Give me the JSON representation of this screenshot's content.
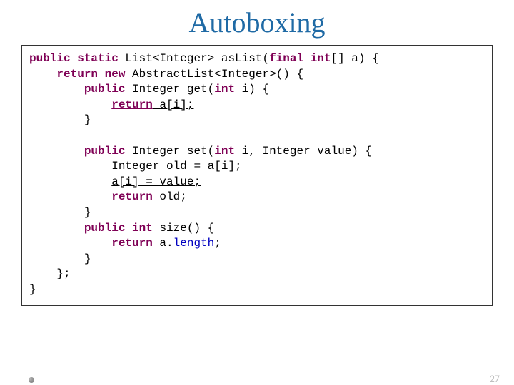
{
  "title": "Autoboxing",
  "slide_number": "27",
  "code": {
    "l1": {
      "a": "public",
      "b": " ",
      "c": "static",
      "d": " List<Integer> asList(",
      "e": "final",
      "f": " ",
      "g": "int",
      "h": "[] a) {"
    },
    "l2": {
      "a": "    ",
      "b": "return",
      "c": " ",
      "d": "new",
      "e": " AbstractList<Integer>() {"
    },
    "l3": {
      "a": "        ",
      "b": "public",
      "c": " Integer get(",
      "d": "int",
      "e": " i) {"
    },
    "l4": {
      "a": "            ",
      "b": "return",
      "c": " a[i];"
    },
    "l5": "        }",
    "l6": "",
    "l7": {
      "a": "        ",
      "b": "public",
      "c": " Integer set(",
      "d": "int",
      "e": " i, Integer value) {"
    },
    "l8": {
      "a": "            ",
      "b": "Integer old = a[i];"
    },
    "l9": {
      "a": "            ",
      "b": "a[i] = value;"
    },
    "l10": {
      "a": "            ",
      "b": "return",
      "c": " old;"
    },
    "l11": "        }",
    "l12": {
      "a": "        ",
      "b": "public",
      "c": " ",
      "d": "int",
      "e": " size() {"
    },
    "l13": {
      "a": "            ",
      "b": "return",
      "c": " a.",
      "d": "length",
      "e": ";"
    },
    "l14": "        }",
    "l15": "    };",
    "l16": "}"
  }
}
